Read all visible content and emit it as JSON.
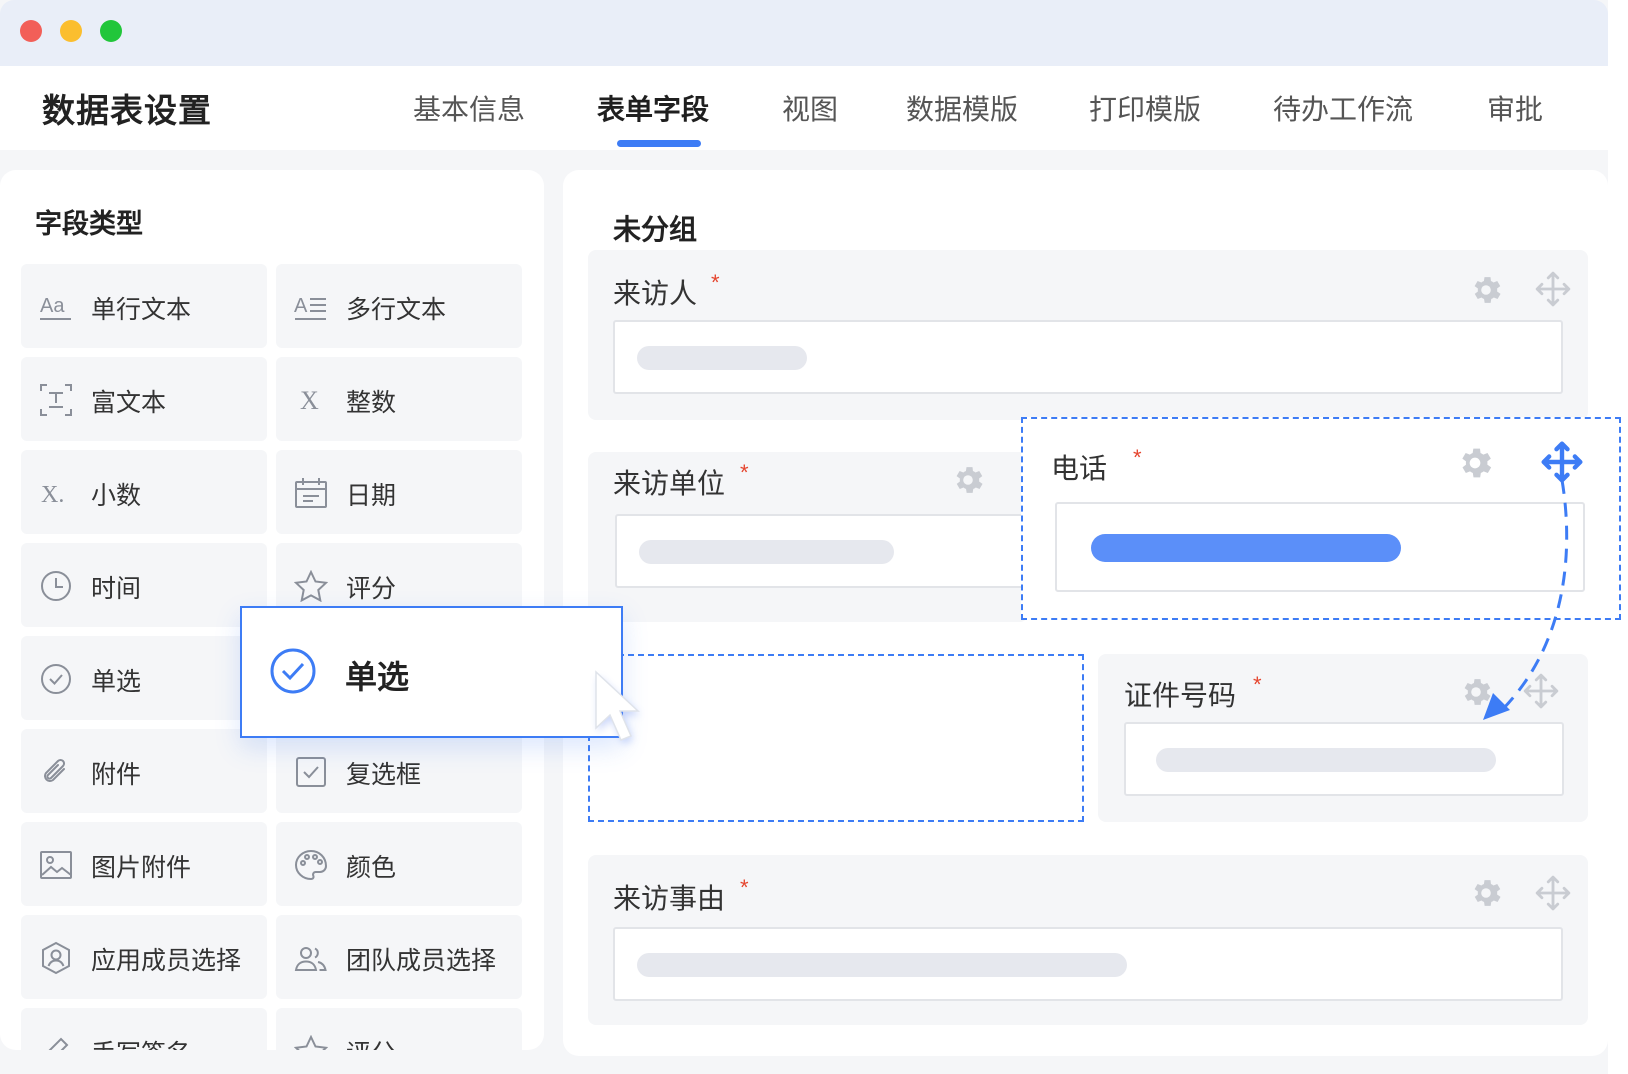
{
  "window": {
    "controls": [
      "close",
      "minimize",
      "maximize"
    ],
    "colors": {
      "close": "#f25f58",
      "minimize": "#fbbe2e",
      "maximize": "#21c63a"
    }
  },
  "header": {
    "title": "数据表设置",
    "tabs": [
      {
        "label": "基本信息",
        "active": false
      },
      {
        "label": "表单字段",
        "active": true
      },
      {
        "label": "视图",
        "active": false
      },
      {
        "label": "数据模版",
        "active": false
      },
      {
        "label": "打印模版",
        "active": false
      },
      {
        "label": "待办工作流",
        "active": false
      },
      {
        "label": "审批",
        "active": false
      }
    ]
  },
  "sidebar": {
    "title": "字段类型",
    "items": [
      {
        "label": "单行文本",
        "icon": "single-line-text-icon"
      },
      {
        "label": "多行文本",
        "icon": "multi-line-text-icon"
      },
      {
        "label": "富文本",
        "icon": "rich-text-icon"
      },
      {
        "label": "整数",
        "icon": "integer-icon"
      },
      {
        "label": "小数",
        "icon": "decimal-icon"
      },
      {
        "label": "日期",
        "icon": "calendar-icon"
      },
      {
        "label": "时间",
        "icon": "clock-icon"
      },
      {
        "label": "评分",
        "icon": "star-icon"
      },
      {
        "label": "单选",
        "icon": "radio-check-icon"
      },
      {
        "label": "",
        "icon": ""
      },
      {
        "label": "附件",
        "icon": "paperclip-icon"
      },
      {
        "label": "复选框",
        "icon": "checkbox-icon"
      },
      {
        "label": "图片附件",
        "icon": "image-icon"
      },
      {
        "label": "颜色",
        "icon": "palette-icon"
      },
      {
        "label": "应用成员选择",
        "icon": "member-icon"
      },
      {
        "label": "团队成员选择",
        "icon": "team-icon"
      },
      {
        "label": "手写签名",
        "icon": "signature-icon"
      },
      {
        "label": "评分",
        "icon": "star-icon"
      }
    ]
  },
  "drag_item": {
    "label": "单选",
    "icon": "radio-check-icon"
  },
  "main": {
    "group_title": "未分组",
    "fields": [
      {
        "label": "来访人",
        "required": "*"
      },
      {
        "label": "来访单位",
        "required": "*"
      },
      {
        "label": "电话",
        "required": "*"
      },
      {
        "label": "证件号码",
        "required": "*"
      },
      {
        "label": "来访事由",
        "required": "*"
      }
    ]
  },
  "accent_color": "#3d7cf5"
}
